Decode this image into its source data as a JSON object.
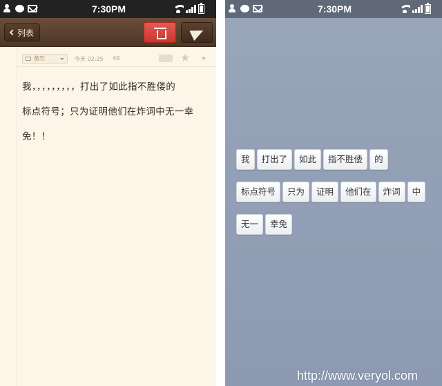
{
  "left": {
    "status": {
      "time": "7:30PM"
    },
    "toolbar": {
      "back_label": "列表"
    },
    "meta": {
      "folder": "备忘",
      "date": "今天 02:25",
      "count": "40",
      "badge": ""
    },
    "note_lines": [
      "我，，，，，，，，，打出了如此指不胜偻的",
      "标点符号；只为证明他们在炸词中无一幸",
      "免！！"
    ]
  },
  "right": {
    "status": {
      "time": "7:30PM"
    },
    "rows": [
      [
        "我",
        "打出了",
        "如此",
        "指不胜偻",
        "的"
      ],
      [
        "标点符号",
        "只为",
        "证明",
        "他们在",
        "炸词",
        "中"
      ],
      [
        "无一",
        "幸免"
      ]
    ]
  },
  "watermark": "http://www.veryol.com",
  "colors": {
    "toolbar_brown": "#5a4030",
    "delete_red": "#d9463e",
    "paper": "#fdf6e8",
    "right_bg": "#93a0b6"
  },
  "icons": [
    "contacts-icon",
    "chat-bubble-icon",
    "mail-icon",
    "wifi-icon",
    "signal-icon",
    "battery-icon",
    "chevron-left-icon",
    "trash-icon",
    "send-icon",
    "folder-icon",
    "star-icon"
  ]
}
